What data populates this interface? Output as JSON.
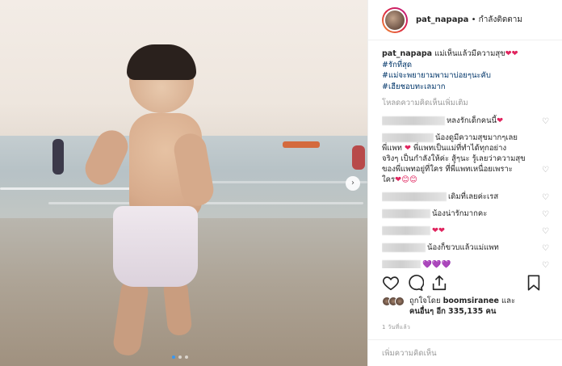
{
  "post": {
    "username": "pat_napapa",
    "follow_status": "• กำลังติดตาม",
    "caption_text": "แม่เห็นแล้วมีความสุข",
    "caption_hearts": "❤❤",
    "hashtags": [
      "#รักที่สุด",
      "#แม่จะพยายามพามาบ่อยๆนะคับ",
      "#เฮียชอบทะเลมาก"
    ],
    "load_more": "โหลดความคิดเห็นเพิ่มเติม"
  },
  "comments": [
    {
      "text": "หลงรักเด็กคนนี้",
      "emoji": "❤"
    },
    {
      "text": "น้องดูมีความสุขมากๆเลย",
      "line2": "พี่แพท",
      "emoji": "❤",
      "line2b": "พี่แพทเป็นแม่ที่ทำได้ทุกอย่าง",
      "line3": "จริงๆ เป็นกำลังให้ค่ะ สู้ๆนะ รู้เลยว่าความสุข",
      "line4": "ของพี่แพทอยู่ที่ใคร ที่พี่แพทเหนื่อยเพราะ",
      "line5": "ใคร",
      "line5_emoji": "❤😊😊"
    },
    {
      "text": "เดิมที่เลยค่ะเรส"
    },
    {
      "text": "น้องน่ารักมากคะ"
    },
    {
      "text": "",
      "emoji": "❤❤"
    },
    {
      "text": "น้องก็ขวบแล้วแม่แพท"
    },
    {
      "text": "",
      "emoji_purple": "💜💜💜"
    }
  ],
  "likes": {
    "liked_by_label": "ถูกใจโดย",
    "liked_by_user": "boomsiranee",
    "and_label": "และ",
    "others_label": "คนอื่นๆ อีก",
    "others_count": "335,135 คน"
  },
  "time_ago": "1 วันที่แล้ว",
  "add_comment_placeholder": "เพิ่มความคิดเห็น",
  "icons": [
    "heart-icon",
    "comment-icon",
    "share-icon",
    "bookmark-icon",
    "chevron-right-icon"
  ],
  "colors": {
    "hashtag": "#003569",
    "heart": "#e0245e",
    "muted": "#999999",
    "dot_active": "#3897f0"
  }
}
